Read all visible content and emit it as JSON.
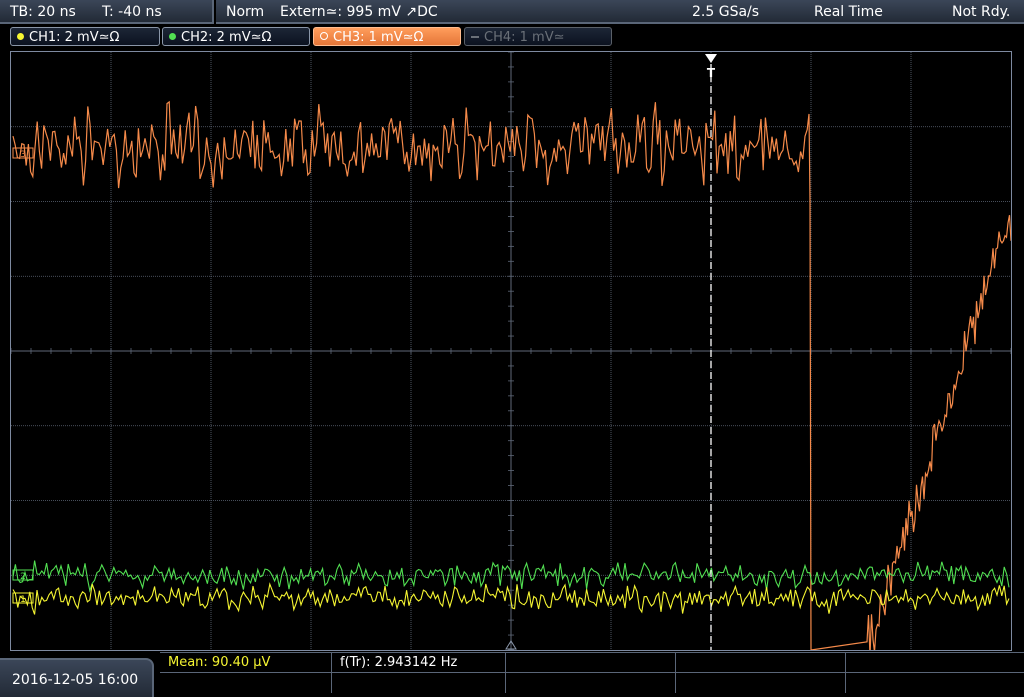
{
  "topbar": {
    "timebase": "TB: 20 ns",
    "trigger_offset": "T: -40 ns",
    "mode": "Norm",
    "trigger_source": "Extern≃: 995 mV ↗DC",
    "sample_rate": "2.5 GSa/s",
    "acq_mode": "Real Time",
    "status": "Not Rdy."
  },
  "channels": [
    {
      "label": "CH1: 2 mV≃Ω",
      "color": "#f5f532",
      "active": true
    },
    {
      "label": "CH2: 2 mV≃Ω",
      "color": "#52e052",
      "active": true
    },
    {
      "label": "CH3: 1 mV≃Ω",
      "color": "#f58a4a",
      "active": true,
      "selected": true
    },
    {
      "label": "CH4: 1 mV≃",
      "color": "#5a6068",
      "active": false
    }
  ],
  "trigger_marker": "T",
  "channel_markers": {
    "ch1": "1",
    "ch2": "2",
    "ch3": "3"
  },
  "bottom": {
    "datetime": "2016-12-05 16:00",
    "mean": "Mean: 90.40 µV",
    "freq": "f(Tr): 2.943142 Hz"
  },
  "colors": {
    "ch1": "#f5f532",
    "ch2": "#52e052",
    "ch3": "#f58a4a",
    "grid": "#5f6878",
    "panel": "#2a3342"
  }
}
